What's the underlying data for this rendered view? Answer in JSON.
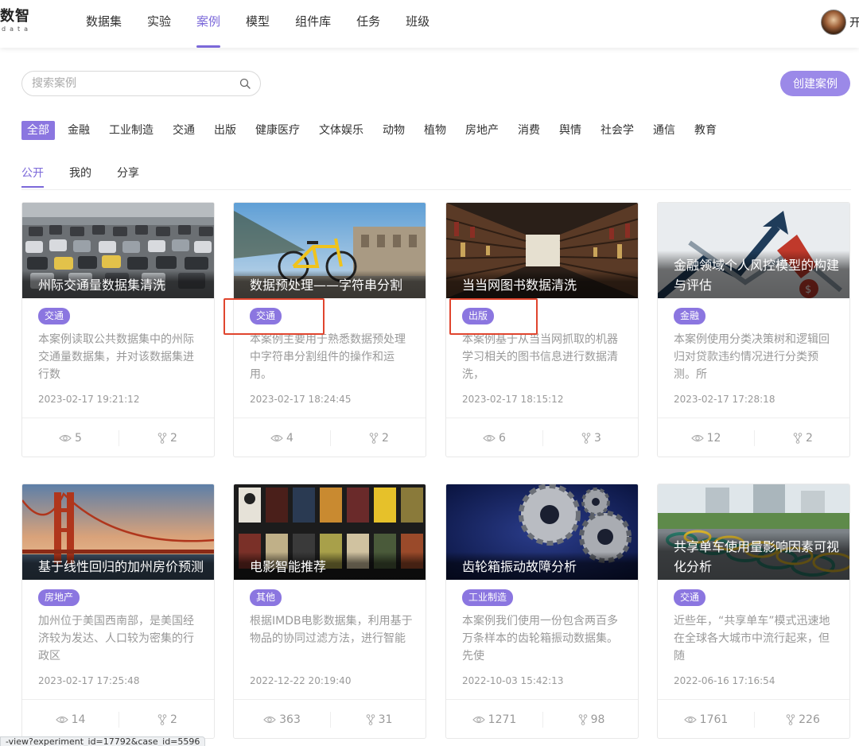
{
  "header": {
    "logo_main": "数智",
    "logo_sub": "data",
    "nav": [
      "数据集",
      "实验",
      "案例",
      "模型",
      "组件库",
      "任务",
      "班级"
    ],
    "active_nav": 2,
    "user_name": "开"
  },
  "search": {
    "placeholder": "搜索案例",
    "value": ""
  },
  "create_button": "创建案例",
  "categories": [
    "全部",
    "金融",
    "工业制造",
    "交通",
    "出版",
    "健康医疗",
    "文体娱乐",
    "动物",
    "植物",
    "房地产",
    "消费",
    "舆情",
    "社会学",
    "通信",
    "教育"
  ],
  "active_category": 0,
  "tabs": [
    "公开",
    "我的",
    "分享"
  ],
  "active_tab": 0,
  "colors": {
    "accent": "#7b68d9",
    "tag_bg": "#8b76e0",
    "create_bg": "#9b89e8",
    "highlight": "#e0452e"
  },
  "cards": [
    {
      "title": "州际交通量数据集清洗",
      "image": "traffic-jam-photo",
      "tag": "交通",
      "desc": "本案例读取公共数据集中的州际交通量数据集，并对该数据集进行数",
      "date": "2023-02-17 19:21:12",
      "views": "5",
      "forks": "2"
    },
    {
      "title": "数据预处理——字符串分割",
      "image": "yellow-bicycle-photo",
      "tag": "交通",
      "desc": "本案例主要用于熟悉数据预处理中字符串分割组件的操作和运用。",
      "date": "2023-02-17 18:24:45",
      "views": "4",
      "forks": "2"
    },
    {
      "title": "当当网图书数据清洗",
      "image": "library-shelves-photo",
      "tag": "出版",
      "desc": "本案例基于从当当网抓取的机器学习相关的图书信息进行数据清洗，",
      "date": "2023-02-17 18:15:12",
      "views": "6",
      "forks": "3"
    },
    {
      "title": "金融领域个人风控模型的构建与评估",
      "image": "finance-arrows-photo",
      "tag": "金融",
      "desc": "本案例使用分类决策树和逻辑回归对贷款违约情况进行分类预测。所",
      "date": "2023-02-17 17:28:18",
      "views": "12",
      "forks": "2"
    },
    {
      "title": "基于线性回归的加州房价预测",
      "image": "golden-gate-bridge-photo",
      "tag": "房地产",
      "desc": "加州位于美国西南部，是美国经济较为发达、人口较为密集的行政区",
      "date": "2023-02-17 17:25:48",
      "views": "14",
      "forks": "2"
    },
    {
      "title": "电影智能推荐",
      "image": "movie-posters-photo",
      "tag": "其他",
      "desc": "根据IMDB电影数据集，利用基于物品的协同过滤方法，进行智能",
      "date": "2022-12-22 20:19:40",
      "views": "363",
      "forks": "31"
    },
    {
      "title": "齿轮箱振动故障分析",
      "image": "gears-photo",
      "tag": "工业制造",
      "desc": "本案例我们使用一份包含两百多万条样本的齿轮箱振动数据集。先使",
      "date": "2022-10-03 15:42:13",
      "views": "1271",
      "forks": "98"
    },
    {
      "title": "共享单车使用量影响因素可视化分析",
      "image": "shared-bikes-photo",
      "tag": "交通",
      "desc": "近些年，“共享单车”模式迅速地在全球各大城市中流行起来，但随",
      "date": "2022-06-16 17:16:54",
      "views": "1761",
      "forks": "226"
    }
  ],
  "status_url": "-view?experiment_id=17792&case_id=5596"
}
